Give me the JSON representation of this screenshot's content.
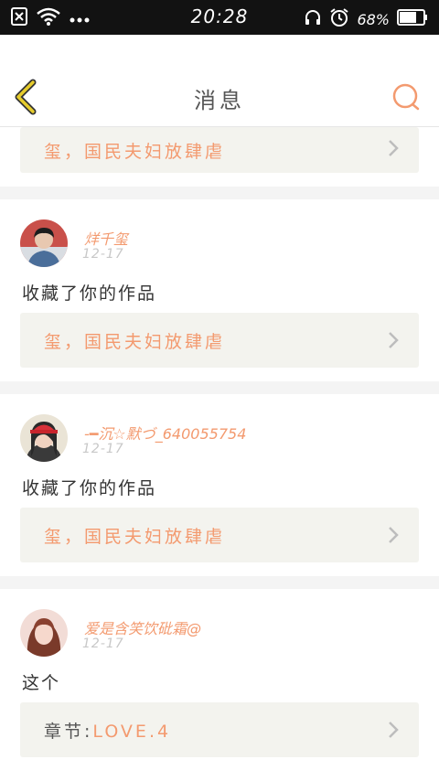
{
  "status_bar": {
    "time": "20:28",
    "battery": "68%",
    "icons": [
      "sim-off-icon",
      "wifi-icon",
      "more-dots-icon",
      "headphones-icon",
      "alarm-icon",
      "battery-icon"
    ]
  },
  "header": {
    "title": "消息",
    "back_icon": "chevron-left-icon",
    "search_icon": "search-icon"
  },
  "colors": {
    "accent": "#f39a6f",
    "back_accent": "#e6cc2c",
    "muted": "#c8c8c8",
    "box_bg": "#f3f3ee"
  },
  "partial_card": {
    "link_text": "玺，国民夫妇放肆虐"
  },
  "messages": [
    {
      "username": "烊千玺",
      "date": "12-17",
      "message": "收藏了你的作品",
      "link_text": "玺，国民夫妇放肆虐"
    },
    {
      "username": "-━沉☆默づ_640055754",
      "date": "12-17",
      "message": "收藏了你的作品",
      "link_text": "玺，国民夫妇放肆虐"
    },
    {
      "username": "爱是含笑饮砒霜@",
      "date": "12-17",
      "message": "这个",
      "link_label": "章节:",
      "link_text": "LOVE.4"
    }
  ]
}
